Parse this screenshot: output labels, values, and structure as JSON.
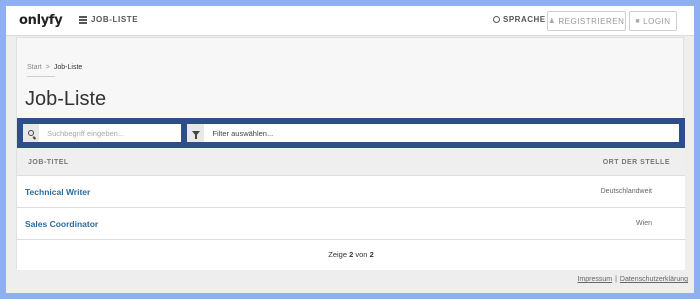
{
  "nav": {
    "logo": "onlyfy",
    "job_list": "JOB-LISTE",
    "language": "SPRACHE",
    "register": "REGISTRIEREN",
    "login": "LOGIN"
  },
  "breadcrumb": {
    "start": "Start",
    "separator": ">",
    "current": "Job-Liste"
  },
  "page": {
    "title": "Job-Liste"
  },
  "filters": {
    "search_placeholder": "Suchbegriff eingeben...",
    "filter_placeholder": "Filter auswählen...",
    "accent_color": "#2c4f8a"
  },
  "table": {
    "headers": {
      "title": "JOB-TITEL",
      "location": "ORT DER STELLE"
    },
    "rows": [
      {
        "title": "Technical Writer",
        "location": "Deutschlandweit"
      },
      {
        "title": "Sales Coordinator",
        "location": "Wien"
      }
    ]
  },
  "pagination": {
    "prefix": "Zeige",
    "shown": "2",
    "mid": "von",
    "total": "2"
  },
  "footer": {
    "imprint": "Impressum",
    "separator": "|",
    "privacy": "Datenschutzerklärung"
  },
  "colors": {
    "background": "#8fb0ef",
    "link": "#2d6b9e"
  }
}
